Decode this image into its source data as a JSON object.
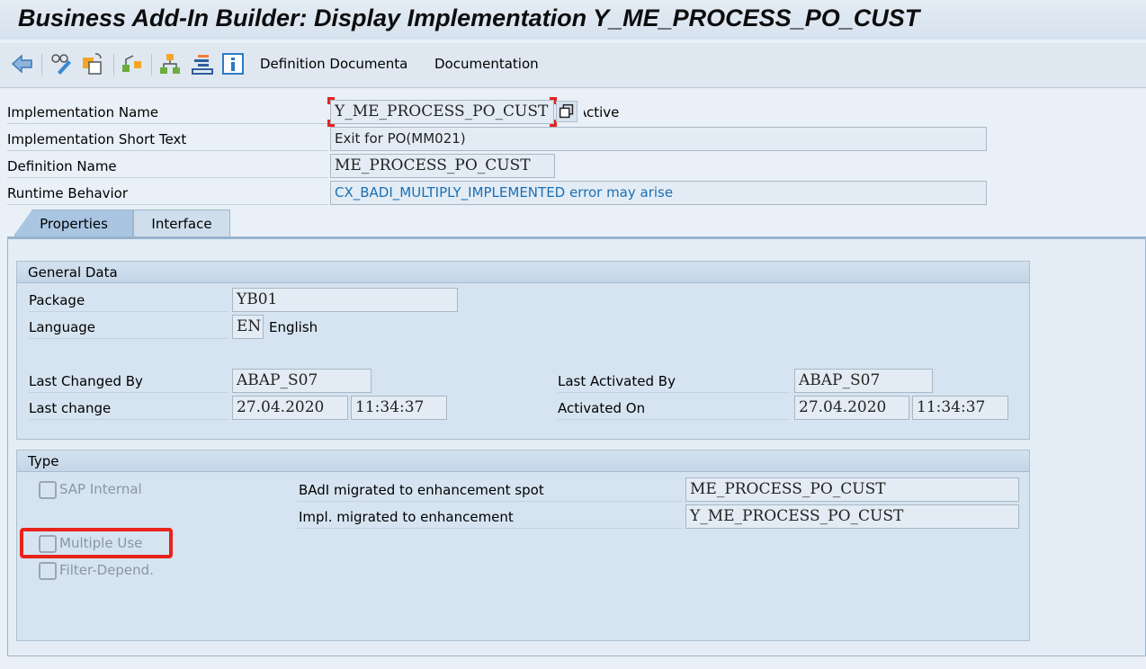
{
  "title": "Business Add-In Builder: Display Implementation Y_ME_PROCESS_PO_CUST",
  "toolbar": {
    "icons": [
      "back-icon",
      "display-change-icon",
      "copy-object-icon",
      "enhancement-icon",
      "hierarchy-icon",
      "list-icon",
      "info-icon"
    ],
    "definition_doc": "Definition Documenta",
    "documentation": "Documentation"
  },
  "header": {
    "impl_name_label": "Implementation Name",
    "impl_name": "Y_ME_PROCESS_PO_CUST",
    "status": "Active",
    "short_text_label": "Implementation Short Text",
    "short_text": "Exit for PO(MM021)",
    "def_name_label": "Definition Name",
    "def_name": "ME_PROCESS_PO_CUST",
    "runtime_label": "Runtime Behavior",
    "runtime": "CX_BADI_MULTIPLY_IMPLEMENTED error may arise"
  },
  "tabs": [
    {
      "label": "Properties",
      "active": true
    },
    {
      "label": "Interface",
      "active": false
    }
  ],
  "general": {
    "title": "General Data",
    "package_label": "Package",
    "package": "YB01",
    "language_label": "Language",
    "language_code": "EN",
    "language": "English",
    "changed_by_label": "Last Changed By",
    "changed_by": "ABAP_S07",
    "last_change_label": "Last change",
    "last_change_date": "27.04.2020",
    "last_change_time": "11:34:37",
    "activated_by_label": "Last Activated By",
    "activated_by": "ABAP_S07",
    "activated_on_label": "Activated On",
    "activated_on_date": "27.04.2020",
    "activated_on_time": "11:34:37"
  },
  "type": {
    "title": "Type",
    "sap_internal": "SAP Internal",
    "multiple_use": "Multiple Use",
    "filter_depend": "Filter-Depend.",
    "badi_migrated_label": "BAdI migrated to enhancement spot",
    "badi_migrated": "ME_PROCESS_PO_CUST",
    "impl_migrated_label": "Impl. migrated to enhancement",
    "impl_migrated": "Y_ME_PROCESS_PO_CUST"
  },
  "colors": {
    "highlight": "#e8231c",
    "runtime_text": "#1a6fb5"
  }
}
